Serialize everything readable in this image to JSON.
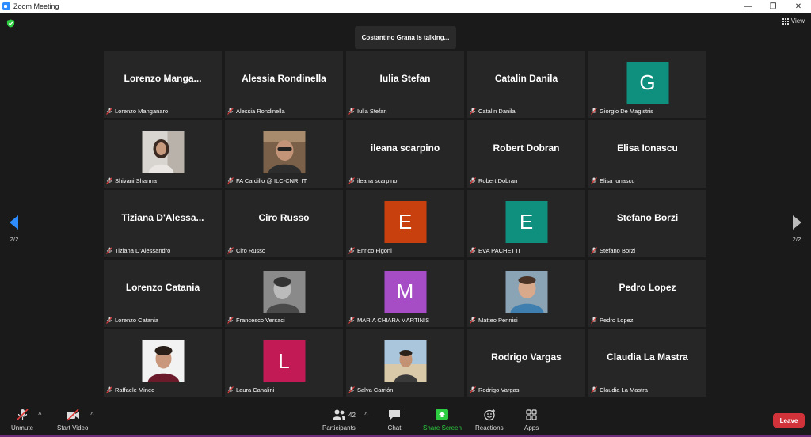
{
  "window": {
    "title": "Zoom Meeting",
    "minimize_label": "—",
    "restore_label": "❐",
    "close_label": "✕"
  },
  "meeting": {
    "talking": "Costantino Grana is talking...",
    "view_label": "View",
    "page_left": "2/2",
    "page_right": "2/2"
  },
  "tiles": [
    {
      "big": "Lorenzo  Manga...",
      "label": "Lorenzo Manganaro"
    },
    {
      "big": "Alessia Rondinella",
      "label": "Alessia Rondinella"
    },
    {
      "big": "Iulia Stefan",
      "label": "Iulia Stefan"
    },
    {
      "big": "Catalin Danila",
      "label": "Catalin Danila"
    },
    {
      "avatar": "G",
      "color": "#0f8f7d",
      "label": "Giorgio De Magistris"
    },
    {
      "photo": "p1",
      "label": "Shivani Sharma"
    },
    {
      "photo": "p2",
      "label": "FA Cardillo @ ILC-CNR, IT"
    },
    {
      "big": "ileana scarpino",
      "label": "ileana scarpino"
    },
    {
      "big": "Robert Dobran",
      "label": "Robert Dobran"
    },
    {
      "big": "Elisa Ionascu",
      "label": "Elisa Ionascu"
    },
    {
      "big": "Tiziana  D'Alessa...",
      "label": "Tiziana D'Alessandro"
    },
    {
      "big": "Ciro Russo",
      "label": "Ciro Russo"
    },
    {
      "avatar": "E",
      "color": "#c9400f",
      "label": "Enrico Figoni"
    },
    {
      "avatar": "E",
      "color": "#0f8f7d",
      "label": "EVA PACHETTI"
    },
    {
      "big": "Stefano Borzi",
      "label": "Stefano Borzi"
    },
    {
      "big": "Lorenzo Catania",
      "label": "Lorenzo Catania"
    },
    {
      "photo": "p3",
      "label": "Francesco Versaci"
    },
    {
      "avatar": "M",
      "color": "#a64dc6",
      "label": "MARIA CHIARA MARTINIS"
    },
    {
      "photo": "p4",
      "label": "Matteo Pennisi"
    },
    {
      "big": "Pedro Lopez",
      "label": "Pedro Lopez"
    },
    {
      "photo": "p5",
      "label": "Raffaele Mineo"
    },
    {
      "avatar": "L",
      "color": "#c21a55",
      "label": "Laura Canalini"
    },
    {
      "photo": "p6",
      "label": "Salva Carrión"
    },
    {
      "big": "Rodrigo Vargas",
      "label": "Rodrigo Vargas"
    },
    {
      "big": "Claudia La Mastra",
      "label": "Claudia La Mastra"
    }
  ],
  "toolbar": {
    "unmute": "Unmute",
    "start_video": "Start Video",
    "participants": "Participants",
    "participant_count": "42",
    "chat": "Chat",
    "share_screen": "Share Screen",
    "reactions": "Reactions",
    "apps": "Apps",
    "leave": "Leave"
  },
  "colors": {
    "share_green": "#2ecc40",
    "leave_red": "#d2323a",
    "mute_red": "#e03a3a"
  }
}
